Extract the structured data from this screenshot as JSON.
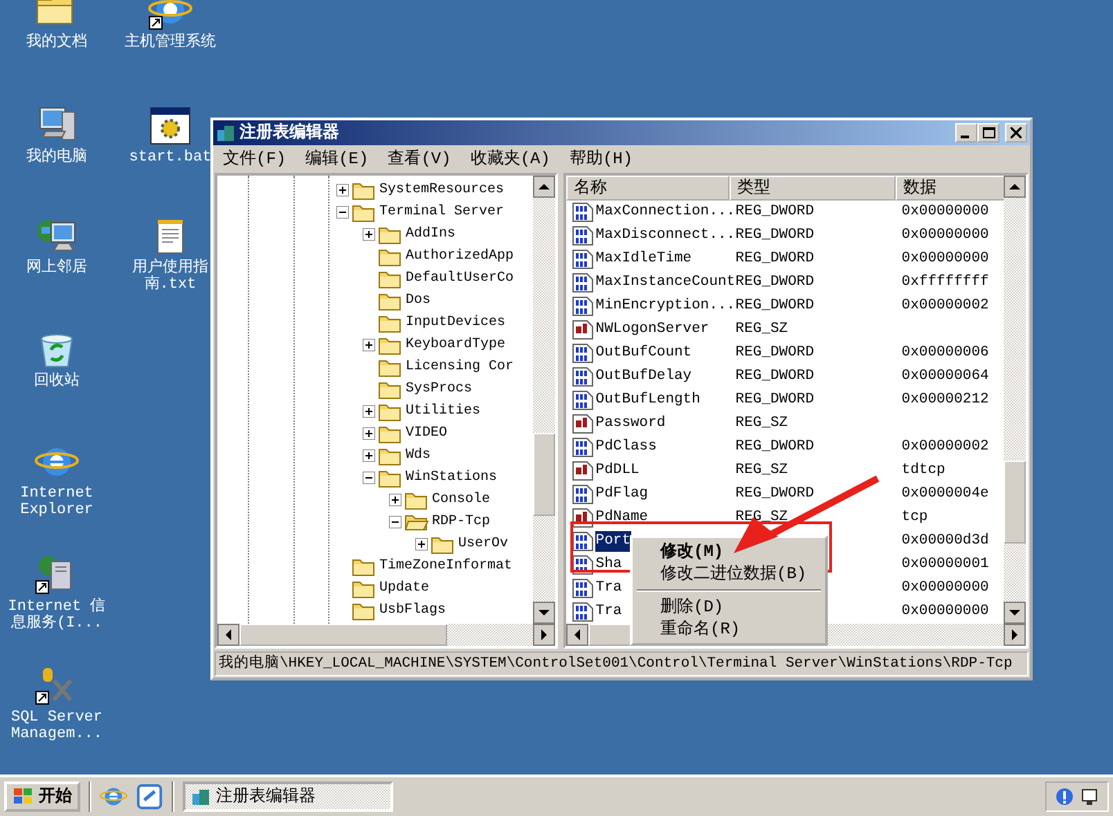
{
  "desktop_columns": [
    [
      {
        "label": "我的文档",
        "kind": "folder"
      },
      {
        "label": "我的电脑",
        "kind": "computer"
      },
      {
        "label": "网上邻居",
        "kind": "network"
      },
      {
        "label": "回收站",
        "kind": "recycle"
      },
      {
        "label": "Internet Explorer",
        "kind": "ie"
      },
      {
        "label": "Internet 信息服务(I...",
        "kind": "server"
      },
      {
        "label": "SQL Server Managem...",
        "kind": "tools"
      }
    ],
    [
      {
        "label": "主机管理系统",
        "kind": "ie-shortcut"
      },
      {
        "label": "start.bat",
        "kind": "batch"
      },
      {
        "label": "用户使用指南.txt",
        "kind": "text"
      }
    ]
  ],
  "window": {
    "title": "注册表编辑器",
    "menu": [
      "文件(F)",
      "编辑(E)",
      "查看(V)",
      "收藏夹(A)",
      "帮助(H)"
    ],
    "tree": [
      {
        "label": "SystemResources",
        "expanded": false
      },
      {
        "label": "Terminal Server",
        "expanded": true,
        "children": [
          {
            "label": "AddIns",
            "expanded": false
          },
          {
            "label": "AuthorizedApp"
          },
          {
            "label": "DefaultUserCo"
          },
          {
            "label": "Dos"
          },
          {
            "label": "InputDevices"
          },
          {
            "label": "KeyboardType",
            "expanded": false
          },
          {
            "label": "Licensing Cor"
          },
          {
            "label": "SysProcs"
          },
          {
            "label": "Utilities",
            "expanded": false
          },
          {
            "label": "VIDEO",
            "expanded": false
          },
          {
            "label": "Wds",
            "expanded": false
          },
          {
            "label": "WinStations",
            "expanded": true,
            "children": [
              {
                "label": "Console",
                "expanded": false
              },
              {
                "label": "RDP-Tcp",
                "expanded": true,
                "children": [
                  {
                    "label": "UserOv",
                    "expanded": false
                  }
                ]
              }
            ]
          }
        ]
      },
      {
        "label": "TimeZoneInformat"
      },
      {
        "label": "Update"
      },
      {
        "label": "UsbFlags"
      }
    ],
    "columns": [
      "名称",
      "类型",
      "数据"
    ],
    "rows": [
      {
        "kind": "dword",
        "name": "MaxConnection...",
        "type": "REG_DWORD",
        "data": "0x00000000",
        "selected": false
      },
      {
        "kind": "dword",
        "name": "MaxDisconnect...",
        "type": "REG_DWORD",
        "data": "0x00000000",
        "selected": false
      },
      {
        "kind": "dword",
        "name": "MaxIdleTime",
        "type": "REG_DWORD",
        "data": "0x00000000",
        "selected": false
      },
      {
        "kind": "dword",
        "name": "MaxInstanceCount",
        "type": "REG_DWORD",
        "data": "0xffffffff",
        "selected": false
      },
      {
        "kind": "dword",
        "name": "MinEncryption...",
        "type": "REG_DWORD",
        "data": "0x00000002",
        "selected": false
      },
      {
        "kind": "string",
        "name": "NWLogonServer",
        "type": "REG_SZ",
        "data": "",
        "selected": false
      },
      {
        "kind": "dword",
        "name": "OutBufCount",
        "type": "REG_DWORD",
        "data": "0x00000006",
        "selected": false
      },
      {
        "kind": "dword",
        "name": "OutBufDelay",
        "type": "REG_DWORD",
        "data": "0x00000064",
        "selected": false
      },
      {
        "kind": "dword",
        "name": "OutBufLength",
        "type": "REG_DWORD",
        "data": "0x00000212",
        "selected": false
      },
      {
        "kind": "string",
        "name": "Password",
        "type": "REG_SZ",
        "data": "",
        "selected": false
      },
      {
        "kind": "dword",
        "name": "PdClass",
        "type": "REG_DWORD",
        "data": "0x00000002",
        "selected": false
      },
      {
        "kind": "string",
        "name": "PdDLL",
        "type": "REG_SZ",
        "data": "tdtcp",
        "selected": false
      },
      {
        "kind": "dword",
        "name": "PdFlag",
        "type": "REG_DWORD",
        "data": "0x0000004e",
        "selected": false
      },
      {
        "kind": "string",
        "name": "PdName",
        "type": "REG_SZ",
        "data": "tcp",
        "selected": false
      },
      {
        "kind": "dword",
        "name": "Port",
        "type": "",
        "data": "0x00000d3d",
        "selected": true
      },
      {
        "kind": "dword",
        "name": "Sha",
        "type": "",
        "data": "0x00000001",
        "selected": false
      },
      {
        "kind": "dword",
        "name": "Tra",
        "type": "",
        "data": "0x00000000",
        "selected": false
      },
      {
        "kind": "dword",
        "name": "Tra",
        "type": "",
        "data": "0x00000000",
        "selected": false
      }
    ],
    "status_bar": "我的电脑\\HKEY_LOCAL_MACHINE\\SYSTEM\\ControlSet001\\Control\\Terminal Server\\WinStations\\RDP-Tcp"
  },
  "context_menu": [
    {
      "kind": "item",
      "label": "修改(M)",
      "default": true
    },
    {
      "kind": "item",
      "label": "修改二进位数据(B)",
      "default": false
    },
    {
      "kind": "separator"
    },
    {
      "kind": "item",
      "label": "删除(D)",
      "default": false
    },
    {
      "kind": "item",
      "label": "重命名(R)",
      "default": false
    }
  ],
  "taskbar": {
    "start": "开始",
    "tasks": [
      {
        "label": "注册表编辑器",
        "selected": true
      }
    ]
  }
}
